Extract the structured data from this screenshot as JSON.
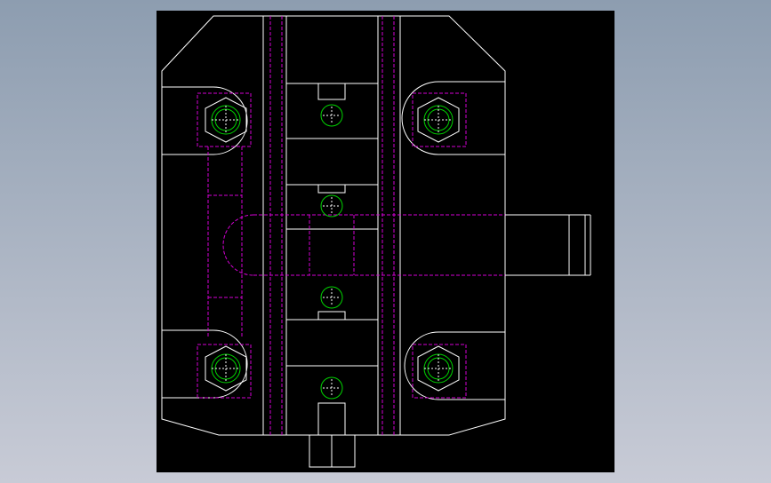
{
  "colors": {
    "background_top": "#8d9db0",
    "background_bottom": "#c8cbd6",
    "canvas": "#000000",
    "outline": "#ffffff",
    "hidden_line": "#d400d4",
    "circle": "#00d400"
  },
  "viewport": {
    "background": "gradient-blue-grey",
    "drawing": "cad-2d-wireframe"
  }
}
